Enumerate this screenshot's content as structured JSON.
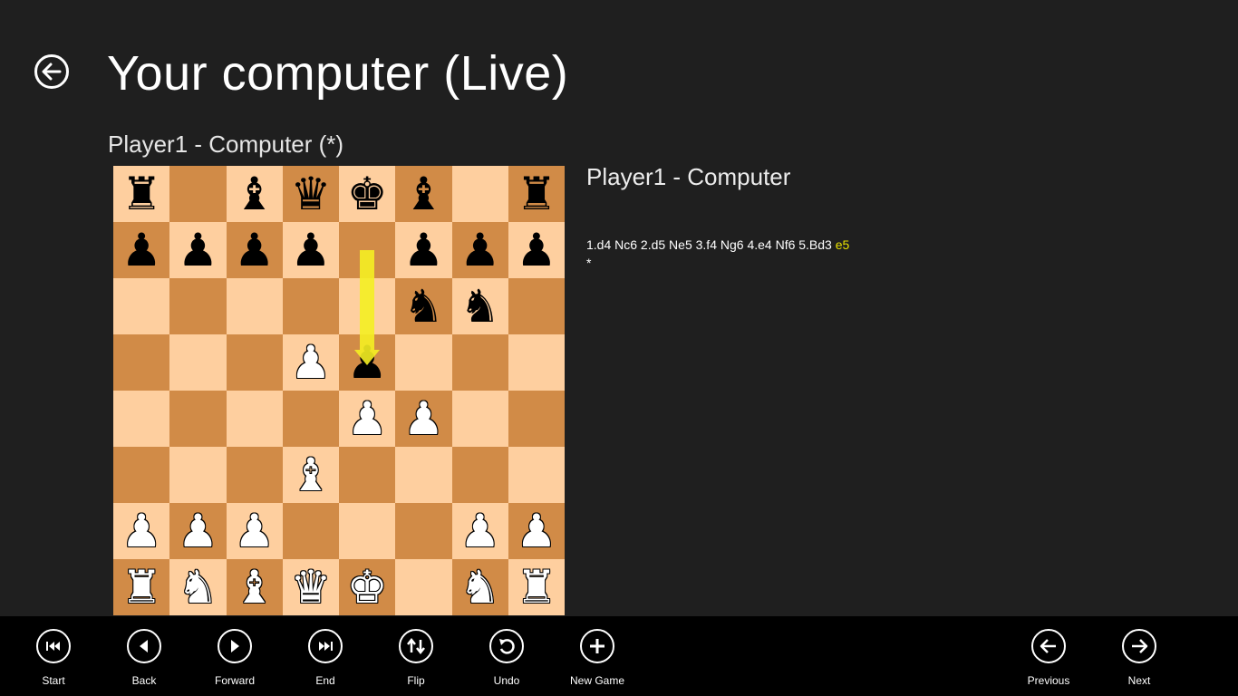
{
  "header": {
    "title": "Your computer (Live)",
    "board_caption": "Player1 - Computer (*)"
  },
  "board": {
    "ranks": [
      [
        {
          "p": "♜",
          "c": "black"
        },
        null,
        {
          "p": "♝",
          "c": "black"
        },
        {
          "p": "♛",
          "c": "black"
        },
        {
          "p": "♚",
          "c": "black"
        },
        {
          "p": "♝",
          "c": "black"
        },
        null,
        {
          "p": "♜",
          "c": "black"
        }
      ],
      [
        {
          "p": "♟",
          "c": "black"
        },
        {
          "p": "♟",
          "c": "black"
        },
        {
          "p": "♟",
          "c": "black"
        },
        {
          "p": "♟",
          "c": "black"
        },
        null,
        {
          "p": "♟",
          "c": "black"
        },
        {
          "p": "♟",
          "c": "black"
        },
        {
          "p": "♟",
          "c": "black"
        }
      ],
      [
        null,
        null,
        null,
        null,
        null,
        {
          "p": "♞",
          "c": "black"
        },
        {
          "p": "♞",
          "c": "black"
        },
        null
      ],
      [
        null,
        null,
        null,
        {
          "p": "♟",
          "c": "white"
        },
        {
          "p": "♟",
          "c": "black"
        },
        null,
        null,
        null
      ],
      [
        null,
        null,
        null,
        null,
        {
          "p": "♟",
          "c": "white"
        },
        {
          "p": "♟",
          "c": "white"
        },
        null,
        null
      ],
      [
        null,
        null,
        null,
        {
          "p": "♝",
          "c": "white"
        },
        null,
        null,
        null,
        null
      ],
      [
        {
          "p": "♟",
          "c": "white"
        },
        {
          "p": "♟",
          "c": "white"
        },
        {
          "p": "♟",
          "c": "white"
        },
        null,
        null,
        null,
        {
          "p": "♟",
          "c": "white"
        },
        {
          "p": "♟",
          "c": "white"
        }
      ],
      [
        {
          "p": "♜",
          "c": "white"
        },
        {
          "p": "♞",
          "c": "white"
        },
        {
          "p": "♝",
          "c": "white"
        },
        {
          "p": "♛",
          "c": "white"
        },
        {
          "p": "♚",
          "c": "white"
        },
        null,
        {
          "p": "♞",
          "c": "white"
        },
        {
          "p": "♜",
          "c": "white"
        }
      ]
    ],
    "last_move": {
      "from": "e7",
      "to": "e5"
    },
    "colors": {
      "light": "#fecf9f",
      "dark": "#d18b47",
      "arrow": "#f4ee22"
    }
  },
  "game": {
    "title": "Player1 - Computer",
    "moves": "1.d4 Nc6 2.d5 Ne5 3.f4 Ng6 4.e4 Nf6 5.Bd3",
    "last_move_text": "e5",
    "result": "*"
  },
  "appbar": {
    "left": [
      {
        "label": "Start",
        "icon": "skip-start-icon"
      },
      {
        "label": "Back",
        "icon": "back-icon"
      },
      {
        "label": "Forward",
        "icon": "forward-icon"
      },
      {
        "label": "End",
        "icon": "skip-end-icon"
      },
      {
        "label": "Flip",
        "icon": "flip-icon"
      },
      {
        "label": "Undo",
        "icon": "undo-icon"
      },
      {
        "label": "New Game",
        "icon": "plus-icon"
      }
    ],
    "right": [
      {
        "label": "Previous",
        "icon": "arrow-left-icon"
      },
      {
        "label": "Next",
        "icon": "arrow-right-icon"
      }
    ]
  }
}
